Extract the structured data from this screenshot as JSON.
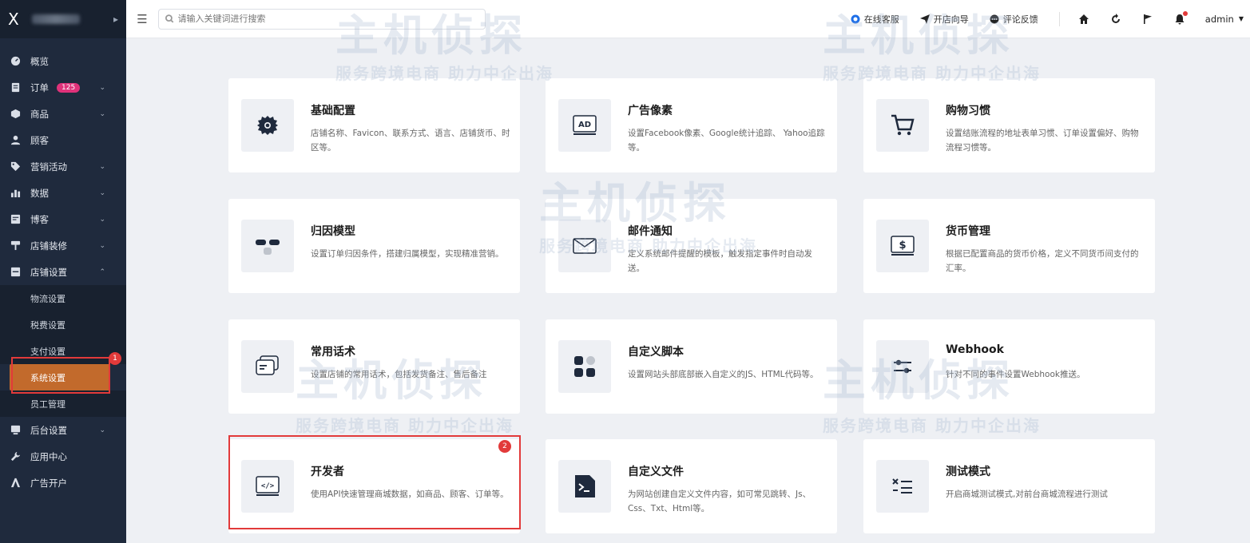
{
  "brand": {
    "logo": "X",
    "expand_icon": "chevron-right-icon"
  },
  "sidebar": {
    "items": [
      {
        "id": "overview",
        "label": "概览",
        "icon": "dashboard-icon",
        "chev": false
      },
      {
        "id": "orders",
        "label": "订单",
        "icon": "order-icon",
        "badge": "125",
        "chev": true
      },
      {
        "id": "products",
        "label": "商品",
        "icon": "box-icon",
        "chev": true
      },
      {
        "id": "customers",
        "label": "顾客",
        "icon": "user-icon",
        "chev": false
      },
      {
        "id": "marketing",
        "label": "营销活动",
        "icon": "tag-icon",
        "chev": true
      },
      {
        "id": "data",
        "label": "数据",
        "icon": "bar-chart-icon",
        "chev": true
      },
      {
        "id": "blog",
        "label": "博客",
        "icon": "blog-icon",
        "chev": true
      },
      {
        "id": "decoration",
        "label": "店铺装修",
        "icon": "brush-icon",
        "chev": true
      },
      {
        "id": "store-settings",
        "label": "店铺设置",
        "icon": "store-icon",
        "chev": true,
        "expanded": true
      }
    ],
    "sub_items": [
      {
        "id": "logistics",
        "label": "物流设置"
      },
      {
        "id": "tax",
        "label": "税费设置"
      },
      {
        "id": "payment",
        "label": "支付设置"
      },
      {
        "id": "system",
        "label": "系统设置",
        "active": true
      },
      {
        "id": "staff",
        "label": "员工管理"
      }
    ],
    "items_after": [
      {
        "id": "admin-settings",
        "label": "后台设置",
        "icon": "monitor-icon",
        "chev": true
      },
      {
        "id": "apps",
        "label": "应用中心",
        "icon": "wrench-icon",
        "chev": false
      },
      {
        "id": "ads",
        "label": "广告开户",
        "icon": "ad-icon",
        "chev": false
      }
    ],
    "annotation_1": "1"
  },
  "topbar": {
    "search_placeholder": "请输入关键词进行搜索",
    "online_service": "在线客服",
    "store_guide": "开店向导",
    "feedback": "评论反馈",
    "user": "admin"
  },
  "cards": [
    {
      "title": "基础配置",
      "desc": "店铺名称、Favicon、联系方式、语言、店铺货币、时区等。",
      "icon": "gear-icon"
    },
    {
      "title": "广告像素",
      "desc": "设置Facebook像素、Google统计追踪、 Yahoo追踪等。",
      "icon": "ad-pixel-icon"
    },
    {
      "title": "购物习惯",
      "desc": "设置结账流程的地址表单习惯、订单设置偏好、购物流程习惯等。",
      "icon": "cart-icon"
    },
    {
      "title": "归因模型",
      "desc": "设置订单归因条件，搭建归属模型，实现精准营销。",
      "icon": "attribution-icon"
    },
    {
      "title": "邮件通知",
      "desc": "定义系统邮件提醒的模板，触发指定事件时自动发送。",
      "icon": "mail-icon"
    },
    {
      "title": "货币管理",
      "desc": "根据已配置商品的货币价格，定义不同货币间支付的汇率。",
      "icon": "currency-icon"
    },
    {
      "title": "常用话术",
      "desc": "设置店铺的常用话术，包括发货备注、售后备注",
      "icon": "chat-icon"
    },
    {
      "title": "自定义脚本",
      "desc": "设置网站头部底部嵌入自定义的JS、HTML代码等。",
      "icon": "grid-icon"
    },
    {
      "title": "Webhook",
      "desc": "针对不同的事件设置Webhook推送。",
      "icon": "sliders-icon"
    },
    {
      "title": "开发者",
      "desc": "使用API快速管理商城数据，如商品、顾客、订单等。",
      "icon": "code-icon"
    },
    {
      "title": "自定义文件",
      "desc": "为网站创建自定义文件内容，如可常见跳转、Js、Css、Txt、Html等。",
      "icon": "terminal-file-icon"
    },
    {
      "title": "测试模式",
      "desc": "开启商城测试模式,对前台商城流程进行测试",
      "icon": "test-mode-icon"
    }
  ],
  "annotation_2": "2",
  "watermark": {
    "big": "主机侦探",
    "small": "服务跨境电商 助力中企出海"
  }
}
